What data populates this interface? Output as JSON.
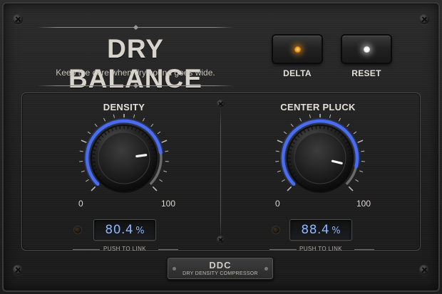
{
  "plugin": {
    "title": "DRY BALANCE",
    "subtitle": "Keep the core when dry sound goes wide."
  },
  "buttons": {
    "delta": {
      "label": "DELTA",
      "led_color": "#f0a020",
      "active": true
    },
    "reset": {
      "label": "RESET",
      "led_color": "#ffffff",
      "active": true
    }
  },
  "knobs": [
    {
      "label": "DENSITY",
      "value": "80.4",
      "unit": "%",
      "level": 0.804,
      "min_label": "0",
      "max_label": "100",
      "link_label": "PUSH TO LINK"
    },
    {
      "label": "CENTER PLUCK",
      "value": "88.4",
      "unit": "%",
      "level": 0.884,
      "min_label": "0",
      "max_label": "100",
      "link_label": "PUSH TO LINK"
    }
  ],
  "badge": {
    "title": "DDC",
    "subtitle": "DRY DENSITY COMPRESSOR"
  },
  "colors": {
    "arc": "#4a6cf0",
    "readout_text": "#8fb5ff"
  }
}
